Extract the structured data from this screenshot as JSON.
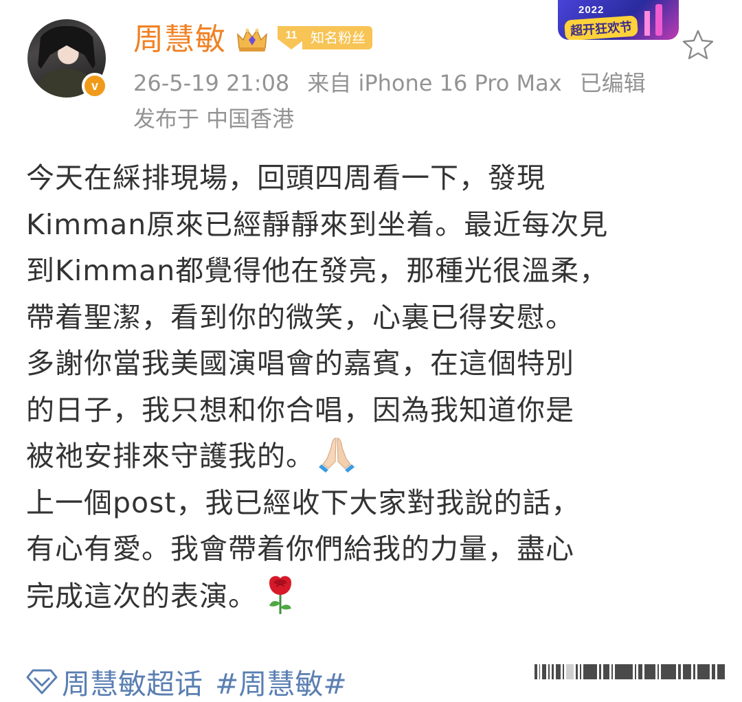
{
  "post": {
    "author": {
      "name": "周慧敏",
      "verified_glyph": "v",
      "fan_badge_level": "11",
      "fan_badge_label": "知名粉丝"
    },
    "event_badge": {
      "year": "2022",
      "name": "超开狂欢节"
    },
    "meta": {
      "time": "26-5-19 21:08",
      "source": "来自 iPhone 16 Pro Max",
      "edited": "已编辑",
      "location": "发布于 中国香港"
    },
    "lines": [
      "今天在綵排現場，回頭四周看一下，發現",
      "Kimman原來已經靜靜來到坐着。最近每次見",
      "到Kimman都覺得他在發亮，那種光很溫柔，",
      "帶着聖潔，看到你的微笑，心裏已得安慰。",
      "多謝你當我美國演唱會的嘉賓，在這個特別",
      "的日子，我只想和你合唱，因為我知道你是",
      "被祂安排來守護我的。",
      "上一個post，我已經收下大家對我說的話，",
      "有心有愛。我會帶着你們給我的力量，盡心",
      "完成這次的表演。"
    ],
    "emoji_1": "pray-emoji",
    "emoji_2": "rose-emoji",
    "supertopic": "周慧敏超话",
    "hashtag": "#周慧敏#"
  },
  "icons": {
    "crown": "crown-icon",
    "star": "star-icon",
    "diamond": "diamond-icon"
  },
  "colors": {
    "username": "#f08124",
    "meta_text": "#939393",
    "body_text": "#333333",
    "link": "#5a7fb2",
    "fan_badge": "#f7c455",
    "verify_badge": "#f19a1a"
  }
}
